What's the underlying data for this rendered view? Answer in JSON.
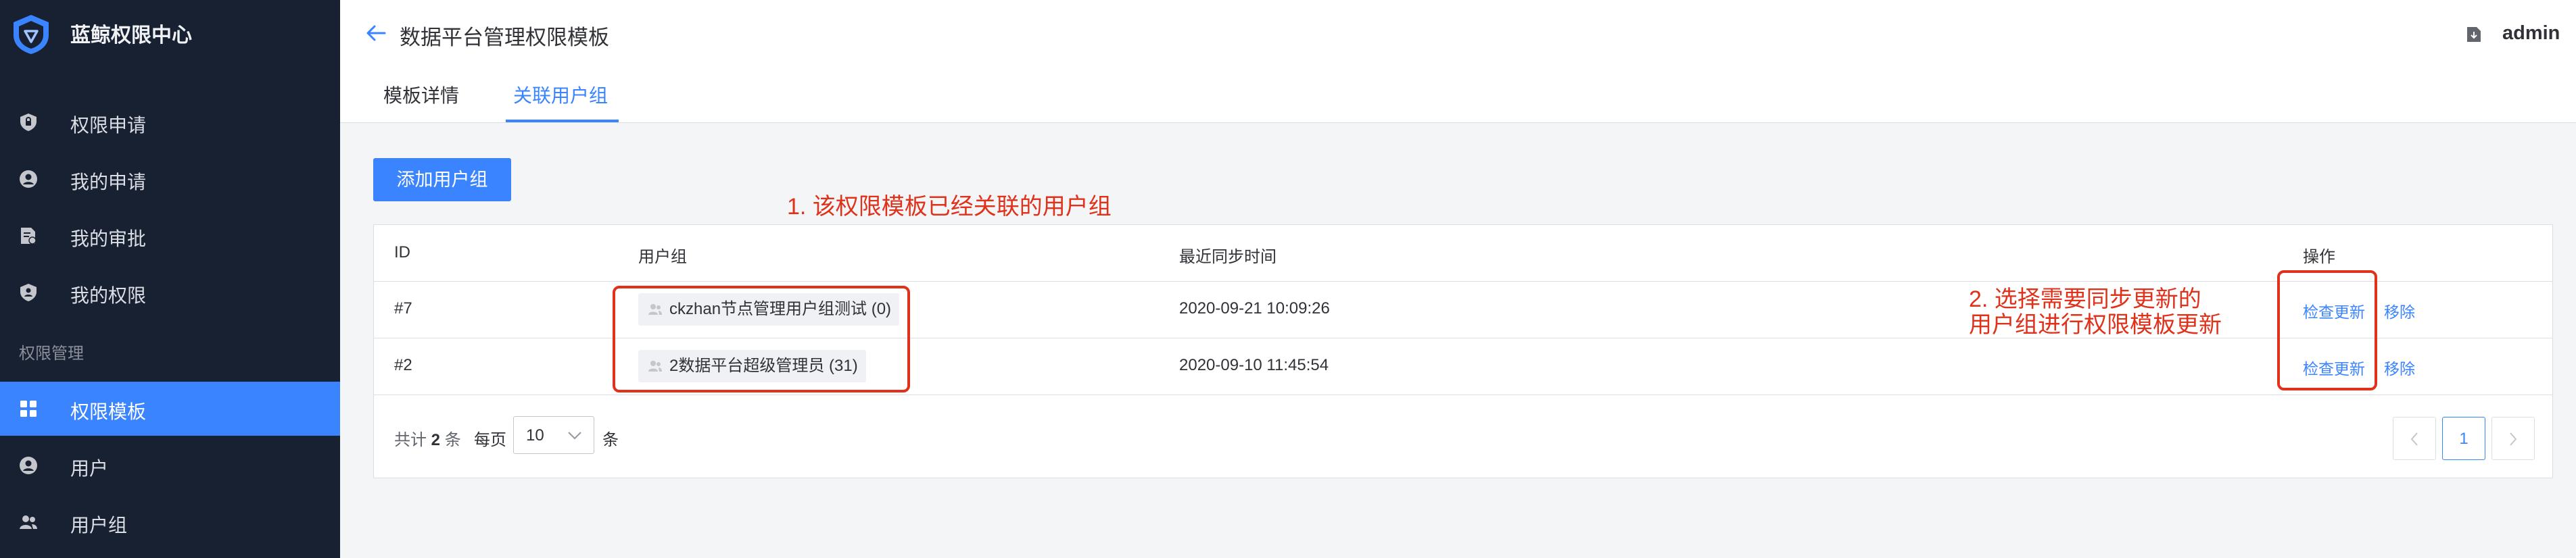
{
  "sidebar": {
    "app_title": "蓝鲸权限中心",
    "items": [
      {
        "label": "权限申请",
        "icon": "shield-lock-icon"
      },
      {
        "label": "我的申请",
        "icon": "person-circle-icon"
      },
      {
        "label": "我的审批",
        "icon": "document-check-icon"
      },
      {
        "label": "我的权限",
        "icon": "shield-person-icon"
      }
    ],
    "group_label": "权限管理",
    "admin_items": [
      {
        "label": "权限模板",
        "icon": "grid-icon",
        "active": true
      },
      {
        "label": "用户",
        "icon": "person-circle-icon"
      },
      {
        "label": "用户组",
        "icon": "people-icon"
      }
    ]
  },
  "header": {
    "title": "数据平台管理权限模板",
    "tabs": [
      "模板详情",
      "关联用户组"
    ],
    "active_tab": "关联用户组",
    "user": "admin"
  },
  "main": {
    "add_button": "添加用户组",
    "table": {
      "columns": [
        "ID",
        "用户组",
        "最近同步时间",
        "操作"
      ],
      "rows": [
        {
          "id": "#7",
          "group": "ckzhan节点管理用户组测试",
          "count": "(0)",
          "sync_time": "2020-09-21 10:09:26",
          "action_check": "检查更新",
          "action_remove": "移除"
        },
        {
          "id": "#2",
          "group": "2数据平台超级管理员",
          "count": "(31)",
          "sync_time": "2020-09-10 11:45:54",
          "action_check": "检查更新",
          "action_remove": "移除"
        }
      ]
    },
    "pagination": {
      "total_prefix": "共计",
      "total": "2",
      "total_suffix": "条",
      "per_page_label": "每页",
      "per_page_value": "10",
      "per_page_unit": "条",
      "current_page": "1"
    }
  },
  "annotations": {
    "note1": "1. 该权限模板已经关联的用户组",
    "note2_line1": "2. 选择需要同步更新的",
    "note2_line2": "用户组进行权限模板更新"
  },
  "colors": {
    "sidebar_bg": "#182132",
    "accent": "#3a84ff",
    "annotation": "#e0311b"
  }
}
